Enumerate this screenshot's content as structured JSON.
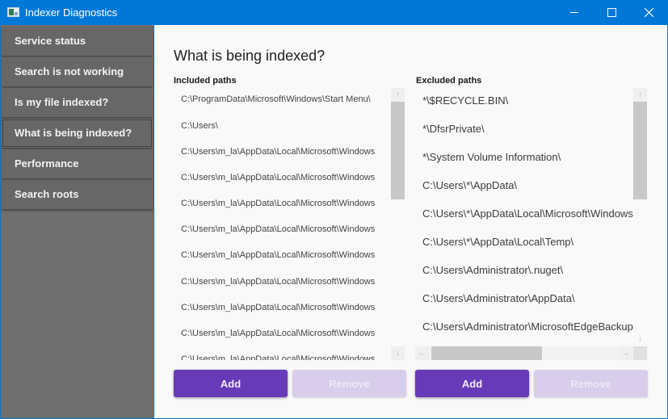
{
  "window": {
    "title": "Indexer Diagnostics",
    "controls": [
      "minimize",
      "maximize",
      "close"
    ]
  },
  "sidebar": {
    "items": [
      {
        "label": "Service status"
      },
      {
        "label": "Search is not working"
      },
      {
        "label": "Is my file indexed?"
      },
      {
        "label": "What is being indexed?",
        "selected": true
      },
      {
        "label": "Performance"
      },
      {
        "label": "Search roots"
      }
    ]
  },
  "main": {
    "title": "What is being indexed?",
    "included": {
      "label": "Included paths",
      "items": [
        "C:\\ProgramData\\Microsoft\\Windows\\Start Menu\\",
        "C:\\Users\\",
        "C:\\Users\\m_la\\AppData\\Local\\Microsoft\\Windows",
        "C:\\Users\\m_la\\AppData\\Local\\Microsoft\\Windows",
        "C:\\Users\\m_la\\AppData\\Local\\Microsoft\\Windows",
        "C:\\Users\\m_la\\AppData\\Local\\Microsoft\\Windows",
        "C:\\Users\\m_la\\AppData\\Local\\Microsoft\\Windows",
        "C:\\Users\\m_la\\AppData\\Local\\Microsoft\\Windows",
        "C:\\Users\\m_la\\AppData\\Local\\Microsoft\\Windows",
        "C:\\Users\\m_la\\AppData\\Local\\Microsoft\\Windows",
        "C:\\Users\\m_la\\AppData\\Local\\Microsoft\\Windows"
      ],
      "add_label": "Add",
      "remove_label": "Remove"
    },
    "excluded": {
      "label": "Excluded paths",
      "items": [
        "*\\$RECYCLE.BIN\\",
        "*\\DfsrPrivate\\",
        "*\\System Volume Information\\",
        "C:\\Users\\*\\AppData\\",
        "C:\\Users\\*\\AppData\\Local\\Microsoft\\Windows",
        "C:\\Users\\*\\AppData\\Local\\Temp\\",
        "C:\\Users\\Administrator\\.nuget\\",
        "C:\\Users\\Administrator\\AppData\\",
        "C:\\Users\\Administrator\\MicrosoftEdgeBackups"
      ],
      "add_label": "Add",
      "remove_label": "Remove"
    }
  },
  "colors": {
    "titlebar": "#0078d7",
    "sidebar": "#6f6f6f",
    "accent": "#673ab7",
    "accent_disabled": "#d9cdec"
  },
  "icons": {
    "scroll_up": "↑",
    "scroll_down": "↓",
    "scroll_left": "←",
    "scroll_right": "→"
  }
}
